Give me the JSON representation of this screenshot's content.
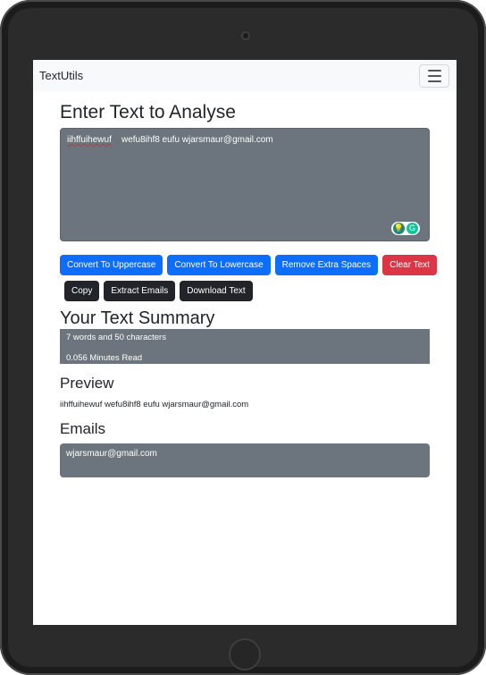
{
  "app": {
    "brand": "TextUtils"
  },
  "navbar": {
    "toggler_icon": "hamburger-menu-icon"
  },
  "form": {
    "heading": "Enter Text to Analyse",
    "text_part1": "iihffuihewuf",
    "text_part2": "    wefu8ihf8 eufu wjarsmaur@gmail.com"
  },
  "buttons": {
    "uppercase": "Convert To Uppercase",
    "lowercase": "Convert To Lowercase",
    "remove_spaces": "Remove Extra Spaces",
    "clear": "Clear Text",
    "copy": "Copy",
    "extract_emails": "Extract Emails",
    "download": "Download Text"
  },
  "summary": {
    "heading": "Your Text Summary",
    "counts": "7 words and 50 characters",
    "read_time": "0.056 Minutes Read"
  },
  "preview": {
    "heading": "Preview",
    "text": "iihffuihewuf wefu8ihf8 eufu wjarsmaur@gmail.com"
  },
  "emails": {
    "heading": "Emails",
    "value": "wjarsmaur@gmail.com"
  },
  "colors": {
    "primary": "#0d6efd",
    "danger": "#dc3545",
    "dark": "#212529",
    "textarea_bg": "#6c757d"
  }
}
